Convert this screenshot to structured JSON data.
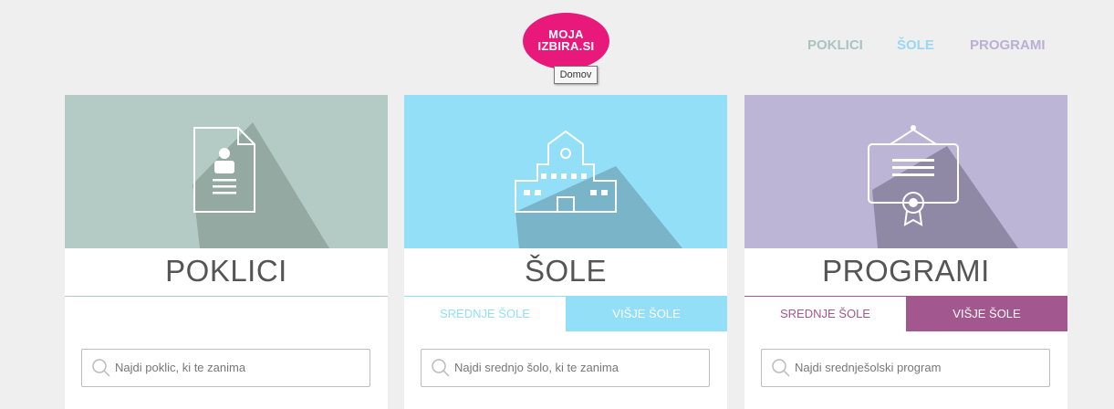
{
  "header": {
    "logo_line1": "MOJA",
    "logo_line2": "IZBIRA.SI",
    "tooltip": "Domov",
    "nav": [
      "POKLICI",
      "ŠOLE",
      "PROGRAMI"
    ]
  },
  "colors": {
    "logo": "#e8197b",
    "poklici_hero": "#b3cbc4",
    "poklici_nav": "#a9c4bd",
    "sole_hero": "#93dff8",
    "sole_nav": "#9ad8f0",
    "programi_hero": "#bdb5d6",
    "programi_nav": "#b9b0d2",
    "programi_active_tab": "#a3578f"
  },
  "cards": [
    {
      "title": "POKLICI",
      "icon": "document-person-icon",
      "tabs": [],
      "search_placeholder": "Najdi poklic, ki te zanima"
    },
    {
      "title": "ŠOLE",
      "icon": "school-building-icon",
      "tabs": [
        {
          "label": "SREDNJE ŠOLE",
          "active": false
        },
        {
          "label": "VIŠJE ŠOLE",
          "active": true
        }
      ],
      "search_placeholder": "Najdi srednjo šolo, ki te zanima"
    },
    {
      "title": "PROGRAMI",
      "icon": "certificate-icon",
      "tabs": [
        {
          "label": "SREDNJE ŠOLE",
          "active": false
        },
        {
          "label": "VIŠJE ŠOLE",
          "active": true
        }
      ],
      "search_placeholder": "Najdi srednješolski program"
    }
  ]
}
